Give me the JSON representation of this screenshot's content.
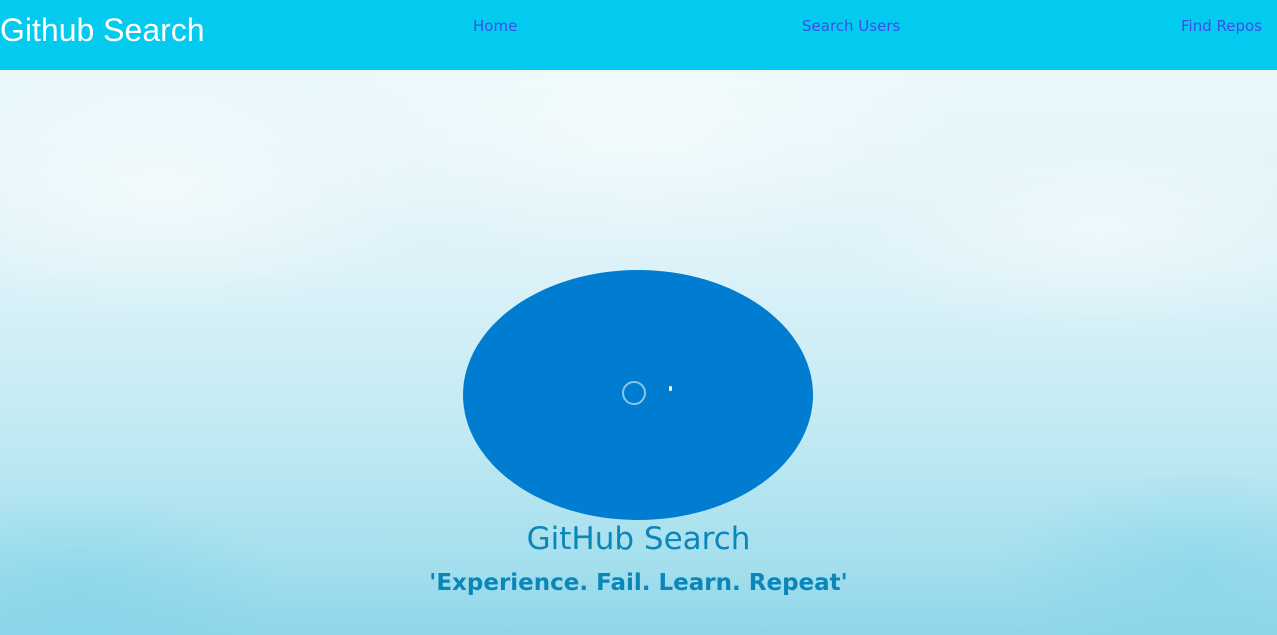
{
  "navbar": {
    "brand": "Github Search",
    "links": {
      "home": "Home",
      "search_users": "Search Users",
      "find_repos": "Find Repos"
    }
  },
  "hero": {
    "title": "GitHub Search",
    "tagline": "'Experience. Fail. Learn. Repeat'"
  },
  "colors": {
    "navbar_background": "#03cbf0",
    "nav_link": "#3f4de8",
    "video_blob": "#007cd1",
    "hero_text": "#0a87b8"
  }
}
